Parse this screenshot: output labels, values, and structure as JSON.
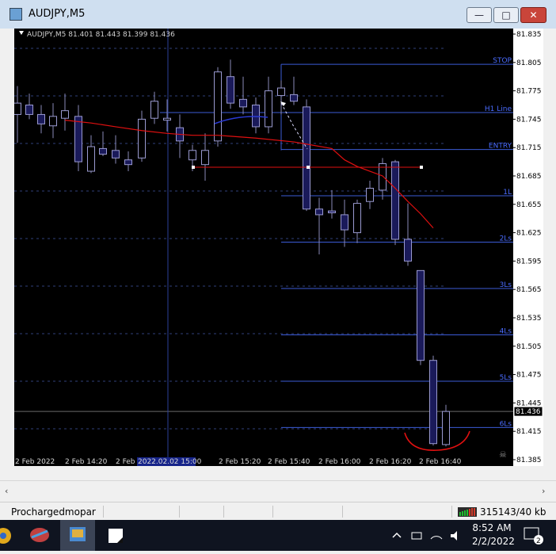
{
  "window": {
    "title": "AUDJPY,M5",
    "minimize_label": "—",
    "maximize_label": "□",
    "close_label": "✕"
  },
  "chart": {
    "header": "AUDJPY,M5  81.401 81.443 81.399 81.436",
    "symbol": "AUDJPY",
    "timeframe": "M5",
    "ohlc": {
      "open": 81.401,
      "high": 81.443,
      "low": 81.399,
      "close": 81.436
    },
    "current_price_label": "81.436",
    "level_labels": [
      "STOP",
      "H1 Line",
      "ENTRY",
      "1L",
      "2Ls",
      "3Ls",
      "4Ls",
      "5Ls",
      "6Ls"
    ],
    "time_labels": [
      "2 Feb 2022",
      "2 Feb 14:20",
      "2 Feb",
      "2 Feb 15:20",
      "2 Feb 15:40",
      "2 Feb 16:00",
      "2 Feb 16:20",
      "2 Feb 16:40"
    ],
    "crosshair_time_label": "2022.02.02 15:00",
    "crosshair_time_suffix": "00",
    "colors": {
      "background": "#000000",
      "grid": "#2f3f7a",
      "candle": "#3a3aa0",
      "level_line": "#3b5bd6",
      "level_label": "#4a6cff",
      "moving_average": "#e01010",
      "annotation": "#e01010"
    }
  },
  "chart_data": {
    "type": "candlestick",
    "title": "AUDJPY,M5",
    "y_ticks": [
      81.835,
      81.805,
      81.775,
      81.745,
      81.715,
      81.685,
      81.655,
      81.625,
      81.595,
      81.565,
      81.535,
      81.505,
      81.475,
      81.445,
      81.415,
      81.385
    ],
    "ylim": [
      81.385,
      81.835
    ],
    "x_tick_labels": [
      "2 Feb 2022",
      "2 Feb 14:20",
      "2 Feb",
      "2 Feb 15:20",
      "2 Feb 15:40",
      "2 Feb 16:00",
      "2 Feb 16:20",
      "2 Feb 16:40"
    ],
    "levels": [
      {
        "name": "STOP",
        "price": 81.803
      },
      {
        "name": "H1 Line",
        "price": 81.752
      },
      {
        "name": "ENTRY",
        "price": 81.713
      },
      {
        "name": "1L",
        "price": 81.664
      },
      {
        "name": "2Ls",
        "price": 81.615
      },
      {
        "name": "3Ls",
        "price": 81.566
      },
      {
        "name": "4Ls",
        "price": 81.517
      },
      {
        "name": "5Ls",
        "price": 81.468
      },
      {
        "name": "6Ls",
        "price": 81.419
      }
    ],
    "current_price": 81.436,
    "candles": [
      {
        "o": 81.75,
        "h": 81.78,
        "l": 81.72,
        "c": 81.762
      },
      {
        "o": 81.76,
        "h": 81.772,
        "l": 81.745,
        "c": 81.75
      },
      {
        "o": 81.75,
        "h": 81.76,
        "l": 81.73,
        "c": 81.74
      },
      {
        "o": 81.738,
        "h": 81.762,
        "l": 81.725,
        "c": 81.748
      },
      {
        "o": 81.746,
        "h": 81.772,
        "l": 81.733,
        "c": 81.754
      },
      {
        "o": 81.748,
        "h": 81.76,
        "l": 81.69,
        "c": 81.7
      },
      {
        "o": 81.69,
        "h": 81.728,
        "l": 81.688,
        "c": 81.716
      },
      {
        "o": 81.714,
        "h": 81.732,
        "l": 81.706,
        "c": 81.708
      },
      {
        "o": 81.712,
        "h": 81.728,
        "l": 81.698,
        "c": 81.704
      },
      {
        "o": 81.702,
        "h": 81.711,
        "l": 81.69,
        "c": 81.697
      },
      {
        "o": 81.704,
        "h": 81.754,
        "l": 81.7,
        "c": 81.745
      },
      {
        "o": 81.746,
        "h": 81.774,
        "l": 81.74,
        "c": 81.764
      },
      {
        "o": 81.744,
        "h": 81.766,
        "l": 81.732,
        "c": 81.746
      },
      {
        "o": 81.736,
        "h": 81.75,
        "l": 81.704,
        "c": 81.722
      },
      {
        "o": 81.702,
        "h": 81.718,
        "l": 81.69,
        "c": 81.712
      },
      {
        "o": 81.697,
        "h": 81.73,
        "l": 81.68,
        "c": 81.712
      },
      {
        "o": 81.722,
        "h": 81.8,
        "l": 81.716,
        "c": 81.795
      },
      {
        "o": 81.79,
        "h": 81.808,
        "l": 81.756,
        "c": 81.762
      },
      {
        "o": 81.766,
        "h": 81.79,
        "l": 81.75,
        "c": 81.758
      },
      {
        "o": 81.76,
        "h": 81.768,
        "l": 81.73,
        "c": 81.737
      },
      {
        "o": 81.737,
        "h": 81.79,
        "l": 81.73,
        "c": 81.775
      },
      {
        "o": 81.77,
        "h": 81.786,
        "l": 81.75,
        "c": 81.778
      },
      {
        "o": 81.771,
        "h": 81.79,
        "l": 81.76,
        "c": 81.764
      },
      {
        "o": 81.758,
        "h": 81.766,
        "l": 81.648,
        "c": 81.65
      },
      {
        "o": 81.65,
        "h": 81.662,
        "l": 81.602,
        "c": 81.644
      },
      {
        "o": 81.648,
        "h": 81.67,
        "l": 81.64,
        "c": 81.646
      },
      {
        "o": 81.644,
        "h": 81.66,
        "l": 81.61,
        "c": 81.628
      },
      {
        "o": 81.625,
        "h": 81.66,
        "l": 81.614,
        "c": 81.656
      },
      {
        "o": 81.658,
        "h": 81.68,
        "l": 81.65,
        "c": 81.672
      },
      {
        "o": 81.67,
        "h": 81.704,
        "l": 81.66,
        "c": 81.698
      },
      {
        "o": 81.7,
        "h": 81.702,
        "l": 81.612,
        "c": 81.618
      },
      {
        "o": 81.618,
        "h": 81.656,
        "l": 81.59,
        "c": 81.595
      },
      {
        "o": 81.585,
        "h": 81.585,
        "l": 81.485,
        "c": 81.49
      },
      {
        "o": 81.49,
        "h": 81.495,
        "l": 81.4,
        "c": 81.402
      },
      {
        "o": 81.401,
        "h": 81.443,
        "l": 81.399,
        "c": 81.436
      }
    ],
    "moving_average": [
      81.744,
      81.741,
      81.737,
      81.733,
      81.73,
      81.728,
      81.728,
      81.727,
      81.725,
      81.721,
      81.714,
      81.702,
      81.695,
      81.69,
      81.685,
      81.672,
      81.658,
      81.645,
      81.63
    ]
  },
  "status": {
    "user": "Prochargedmopar",
    "connection": "315143/40 kb"
  },
  "taskbar": {
    "time": "8:52 AM",
    "date": "2/2/2022",
    "notification_count": "2"
  }
}
